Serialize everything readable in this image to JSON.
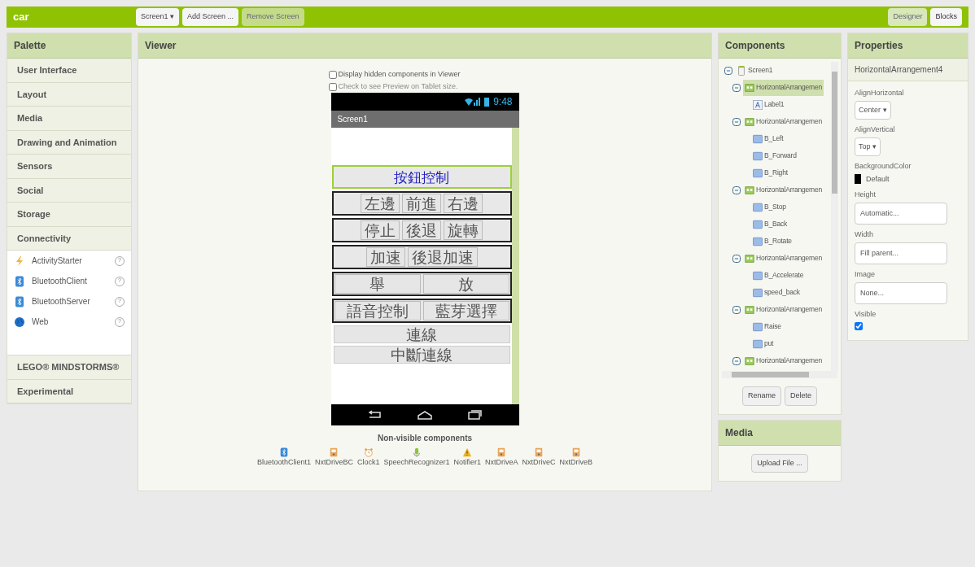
{
  "topbar": {
    "project": "car",
    "screen_select": "Screen1",
    "caret": "▾",
    "buttons": [
      {
        "label": "Add Screen ...",
        "disabled": false
      },
      {
        "label": "Remove Screen",
        "disabled": true
      }
    ],
    "modes": [
      {
        "label": "Designer",
        "selected": true
      },
      {
        "label": "Blocks",
        "selected": false
      }
    ]
  },
  "palette": {
    "title": "Palette",
    "sections": [
      {
        "label": "User Interface"
      },
      {
        "label": "Layout"
      },
      {
        "label": "Media"
      },
      {
        "label": "Drawing and Animation"
      },
      {
        "label": "Sensors"
      },
      {
        "label": "Social"
      },
      {
        "label": "Storage"
      },
      {
        "label": "Connectivity",
        "items": [
          {
            "label": "ActivityStarter",
            "kind": "bolt",
            "help": "?"
          },
          {
            "label": "BluetoothClient",
            "kind": "bluetooth",
            "help": "?"
          },
          {
            "label": "BluetoothServer",
            "kind": "bluetooth",
            "help": "?"
          },
          {
            "label": "Web",
            "kind": "globe",
            "help": "?"
          }
        ]
      },
      {
        "label": "LEGO® MINDSTORMS®"
      },
      {
        "label": "Experimental"
      }
    ]
  },
  "viewer": {
    "title": "Viewer",
    "options": [
      {
        "label": "Display hidden components in Viewer",
        "checked": false
      },
      {
        "label": "Check to see Preview on Tablet size.",
        "checked": false
      }
    ],
    "phone": {
      "time": "9:48",
      "title": "Screen1",
      "rows": [
        {
          "kind": "label",
          "text": "按鈕控制",
          "selected": true
        },
        {
          "kind": "buttons",
          "fill": false,
          "buttons": [
            "左邊",
            "前進",
            "右邊"
          ]
        },
        {
          "kind": "buttons",
          "fill": false,
          "buttons": [
            "停止",
            "後退",
            "旋轉"
          ]
        },
        {
          "kind": "buttons",
          "fill": false,
          "buttons": [
            "加速",
            "後退加速"
          ]
        },
        {
          "kind": "buttons",
          "fill": true,
          "buttons": [
            "舉",
            "放"
          ]
        },
        {
          "kind": "buttons",
          "fill": true,
          "buttons": [
            "語音控制",
            "藍芽選擇"
          ]
        },
        {
          "kind": "button",
          "text": "連線"
        },
        {
          "kind": "button",
          "text": "中斷連線"
        }
      ]
    },
    "nonvisible_title": "Non-visible components",
    "nonvisible": [
      {
        "label": "BluetoothClient1",
        "kind": "bluetooth"
      },
      {
        "label": "NxtDriveBC",
        "kind": "nxt"
      },
      {
        "label": "Clock1",
        "kind": "clock"
      },
      {
        "label": "SpeechRecognizer1",
        "kind": "mic"
      },
      {
        "label": "Notifier1",
        "kind": "warning"
      },
      {
        "label": "NxtDriveA",
        "kind": "nxt"
      },
      {
        "label": "NxtDriveC",
        "kind": "nxt"
      },
      {
        "label": "NxtDriveB",
        "kind": "nxt"
      }
    ]
  },
  "components": {
    "title": "Components",
    "tree": [
      {
        "label": "Screen1",
        "kind": "screen",
        "expanded": true,
        "selected": false,
        "children": [
          {
            "label": "HorizontalArrangemen",
            "kind": "arrangement",
            "expanded": true,
            "selected": true,
            "children": [
              {
                "label": "Label1",
                "kind": "label",
                "selected": false
              }
            ]
          },
          {
            "label": "HorizontalArrangemen",
            "kind": "arrangement",
            "expanded": true,
            "selected": false,
            "children": [
              {
                "label": "B_Left",
                "kind": "button",
                "selected": false
              },
              {
                "label": "B_Forward",
                "kind": "button",
                "selected": false
              },
              {
                "label": "B_Right",
                "kind": "button",
                "selected": false
              }
            ]
          },
          {
            "label": "HorizontalArrangemen",
            "kind": "arrangement",
            "expanded": true,
            "selected": false,
            "children": [
              {
                "label": "B_Stop",
                "kind": "button",
                "selected": false
              },
              {
                "label": "B_Back",
                "kind": "button",
                "selected": false
              },
              {
                "label": "B_Rotate",
                "kind": "button",
                "selected": false
              }
            ]
          },
          {
            "label": "HorizontalArrangemen",
            "kind": "arrangement",
            "expanded": true,
            "selected": false,
            "children": [
              {
                "label": "B_Accelerate",
                "kind": "button",
                "selected": false
              },
              {
                "label": "speed_back",
                "kind": "button",
                "selected": false
              }
            ]
          },
          {
            "label": "HorizontalArrangemen",
            "kind": "arrangement",
            "expanded": true,
            "selected": false,
            "children": [
              {
                "label": "Raise",
                "kind": "button",
                "selected": false
              },
              {
                "label": "put",
                "kind": "button",
                "selected": false
              }
            ]
          },
          {
            "label": "HorizontalArrangemen",
            "kind": "arrangement",
            "expanded": true,
            "selected": false
          }
        ]
      }
    ],
    "buttons": [
      "Rename",
      "Delete"
    ]
  },
  "media": {
    "title": "Media",
    "button": "Upload File ..."
  },
  "properties": {
    "title": "Properties",
    "component": "HorizontalArrangement4",
    "items": [
      {
        "kind": "dropdown",
        "label": "AlignHorizontal",
        "value": "Center",
        "caret": "▾"
      },
      {
        "kind": "dropdown",
        "label": "AlignVertical",
        "value": "Top",
        "caret": "▾"
      },
      {
        "kind": "color",
        "label": "BackgroundColor",
        "value": "Default",
        "color": "#000000"
      },
      {
        "kind": "textbox",
        "label": "Height",
        "value": "Automatic..."
      },
      {
        "kind": "textbox",
        "label": "Width",
        "value": "Fill parent..."
      },
      {
        "kind": "textbox",
        "label": "Image",
        "value": "None..."
      },
      {
        "kind": "checkbox",
        "label": "Visible",
        "checked": true
      }
    ]
  }
}
